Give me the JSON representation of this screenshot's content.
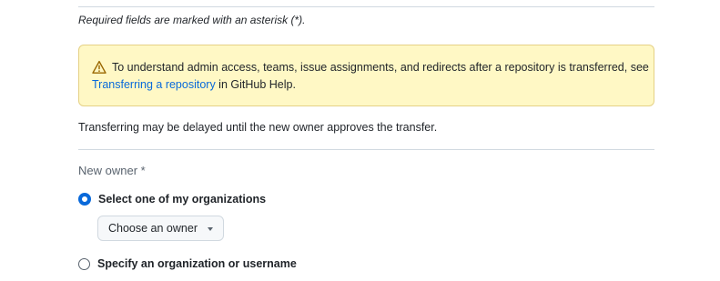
{
  "form": {
    "required_note": "Required fields are marked with an asterisk (*).",
    "warning": {
      "icon": "alert-icon",
      "text_before": "To understand admin access, teams, issue assignments, and redirects after a repository is transferred, see",
      "link_text": "Transferring a repository",
      "text_after": " in GitHub Help."
    },
    "delay_note": "Transferring may be delayed until the new owner approves the transfer.",
    "new_owner_label": "New owner *",
    "options": [
      {
        "label": "Select one of my organizations",
        "checked": true
      },
      {
        "label": "Specify an organization or username",
        "checked": false
      }
    ],
    "owner_select": {
      "label": "Choose an owner",
      "icon": "triangle-down-icon"
    }
  },
  "colors": {
    "accent": "#0969da",
    "warning_bg": "#fff8c5",
    "warning_border": "#e5d186",
    "warning_icon": "#9a6700"
  }
}
